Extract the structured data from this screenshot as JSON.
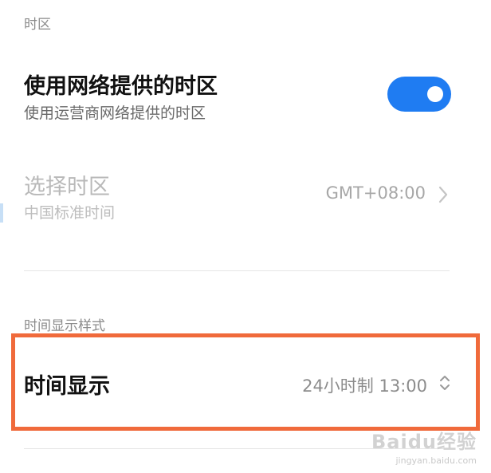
{
  "timezone_section": {
    "label": "时区",
    "network_timezone": {
      "title": "使用网络提供的时区",
      "subtitle": "使用运营商网络提供的时区",
      "enabled": true,
      "accent_color": "#1f7cf2"
    },
    "select_timezone": {
      "title": "选择时区",
      "subtitle": "中国标准时间",
      "value": "GMT+08:00",
      "disabled": true
    }
  },
  "time_format_section": {
    "label": "时间显示样式",
    "time_display": {
      "title": "时间显示",
      "value": "24小时制 13:00"
    },
    "highlight_color": "#f06a3b"
  },
  "watermark": {
    "logo": "Baidu经验",
    "url": "jingyan.baidu.com"
  }
}
